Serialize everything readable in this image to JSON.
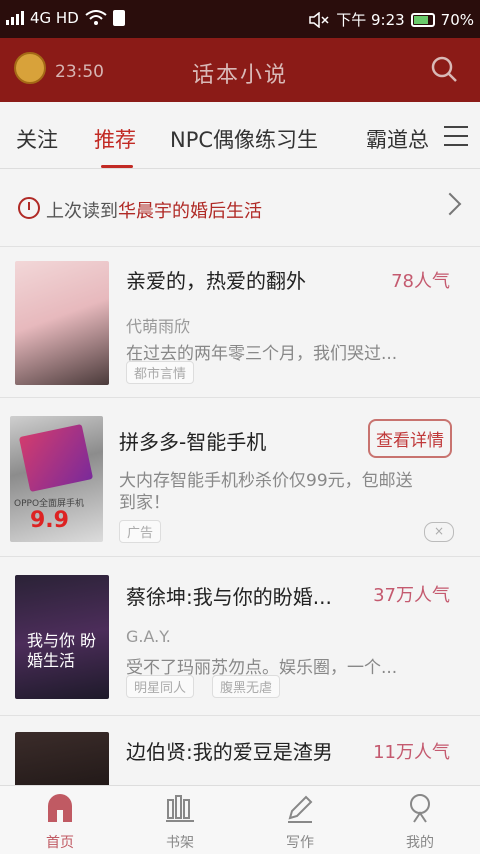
{
  "status_bar": {
    "network": "4G HD",
    "time": "下午 9:23",
    "battery": "70%"
  },
  "app_bar": {
    "time": "23:50",
    "title": "话本小说"
  },
  "tabs": [
    {
      "label": "关注",
      "active": false
    },
    {
      "label": "推荐",
      "active": true
    },
    {
      "label": "NPC偶像练习生",
      "active": false
    },
    {
      "label": "霸道总",
      "active": false
    }
  ],
  "last_read": {
    "prefix": "上次读到",
    "book": "华晨宇的婚后生活"
  },
  "items": [
    {
      "title": "亲爱的，热爱的翻外",
      "popularity": "78人气",
      "author": "代萌雨欣",
      "desc": "在过去的两年零三个月，我们哭过...",
      "tags": [
        "都市言情"
      ]
    },
    {
      "title": "拼多多-智能手机",
      "button": "查看详情",
      "desc_line1": "大内存智能手机秒杀价仅99元，包邮送",
      "desc_line2": "到家！",
      "tag": "广告",
      "close": "×",
      "cover_text": "OPPO全面屏手机",
      "cover_price": "9.9"
    },
    {
      "title": "蔡徐坤:我与你的盼婚...",
      "popularity": "37万人气",
      "author": "G.A.Y.",
      "desc": "受不了玛丽苏勿点。娱乐圈，一个...",
      "tags": [
        "明星同人",
        "腹黑无虐"
      ],
      "cover_text": "我与你 盼婚生活"
    },
    {
      "title": "边伯贤:我的爱豆是渣男",
      "popularity": "11万人气"
    }
  ],
  "bottom_nav": [
    {
      "label": "首页",
      "active": true
    },
    {
      "label": "书架",
      "active": false
    },
    {
      "label": "写作",
      "active": false
    },
    {
      "label": "我的",
      "active": false
    }
  ],
  "colors": {
    "brand": "#8b1b17",
    "accent": "#c22a24",
    "popularity": "#c45a6f"
  }
}
